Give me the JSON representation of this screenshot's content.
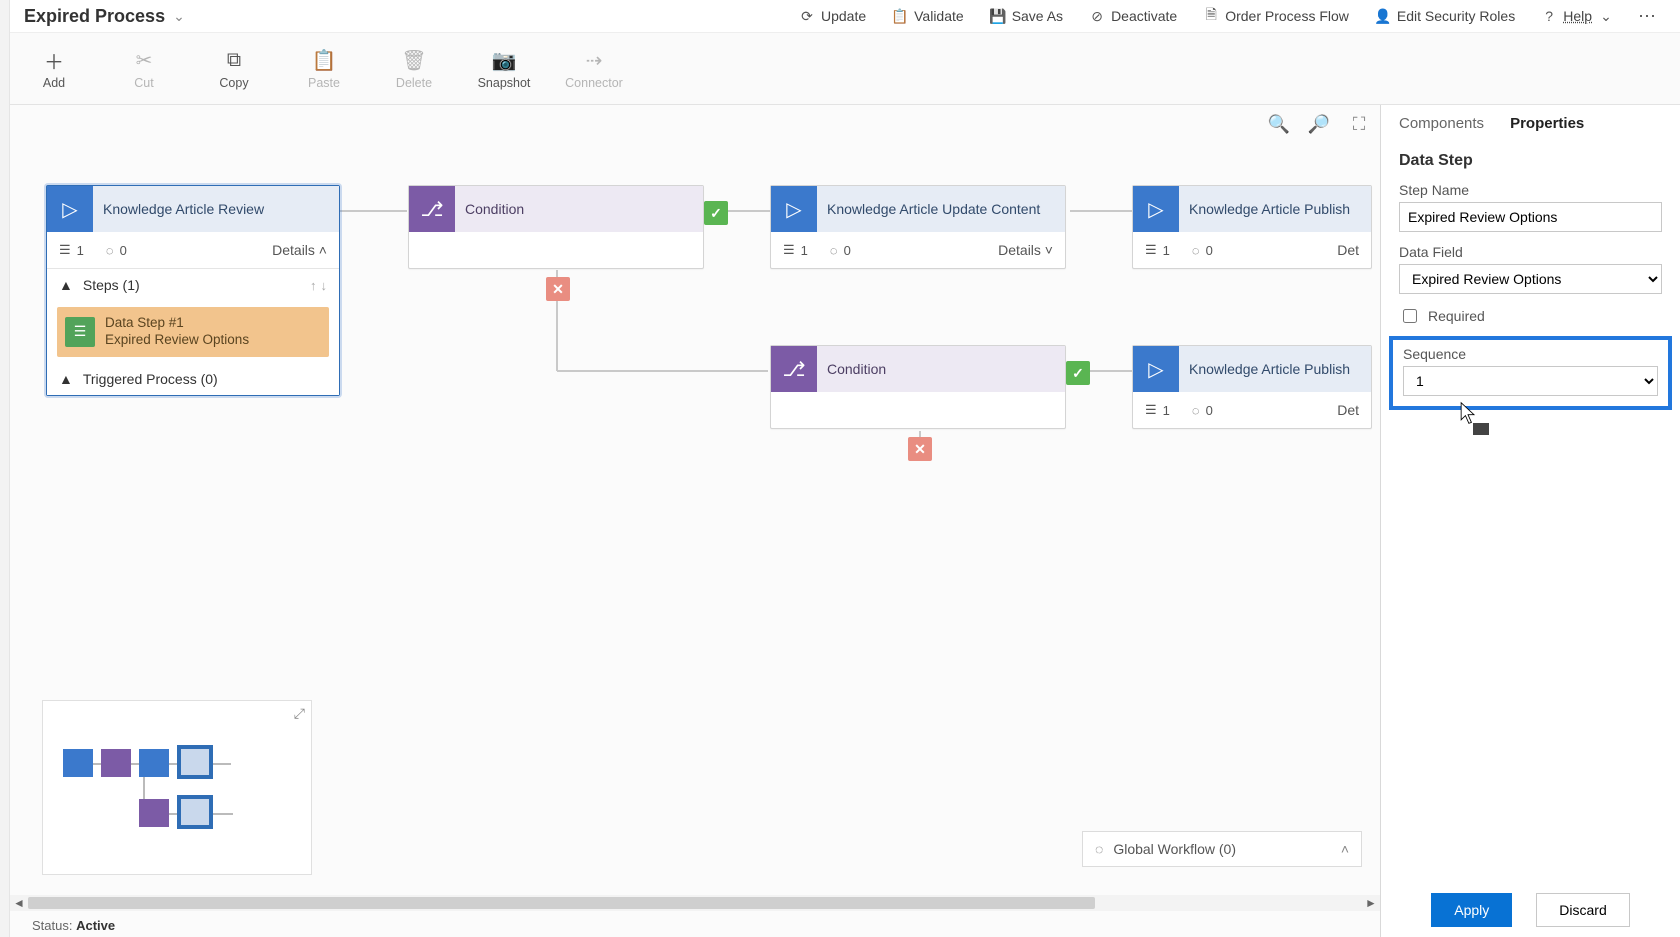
{
  "window": {
    "title": "Expired Process"
  },
  "titlebar_actions": {
    "update": "Update",
    "validate": "Validate",
    "saveas": "Save As",
    "deactivate": "Deactivate",
    "order": "Order Process Flow",
    "security": "Edit Security Roles",
    "help": "Help"
  },
  "ribbon": {
    "add": "Add",
    "cut": "Cut",
    "copy": "Copy",
    "paste": "Paste",
    "delete": "Delete",
    "snapshot": "Snapshot",
    "connector": "Connector"
  },
  "nodes": {
    "n1": {
      "title": "Knowledge Article Review",
      "steps": "1",
      "pending": "0",
      "details": "Details"
    },
    "n2": {
      "title": "Condition"
    },
    "n3": {
      "title": "Knowledge Article Update Content",
      "steps": "1",
      "pending": "0",
      "details": "Details"
    },
    "n4": {
      "title": "Knowledge Article Publish",
      "steps": "1",
      "pending": "0",
      "details": "Det"
    },
    "n5": {
      "title": "Condition"
    },
    "n6": {
      "title": "Knowledge Article Publish",
      "steps": "1",
      "pending": "0",
      "details": "Det"
    }
  },
  "expand": {
    "steps_header": "Steps (1)",
    "datastep_line1": "Data Step #1",
    "datastep_line2": "Expired Review Options",
    "triggered": "Triggered Process (0)"
  },
  "global_workflow": "Global Workflow (0)",
  "status": {
    "label": "Status:",
    "value": "Active"
  },
  "panel": {
    "tabs": {
      "components": "Components",
      "properties": "Properties"
    },
    "section": "Data Step",
    "step_name_label": "Step Name",
    "step_name_value": "Expired Review Options",
    "data_field_label": "Data Field",
    "data_field_value": "Expired Review Options",
    "required_label": "Required",
    "sequence_label": "Sequence",
    "sequence_value": "1",
    "apply": "Apply",
    "discard": "Discard"
  }
}
